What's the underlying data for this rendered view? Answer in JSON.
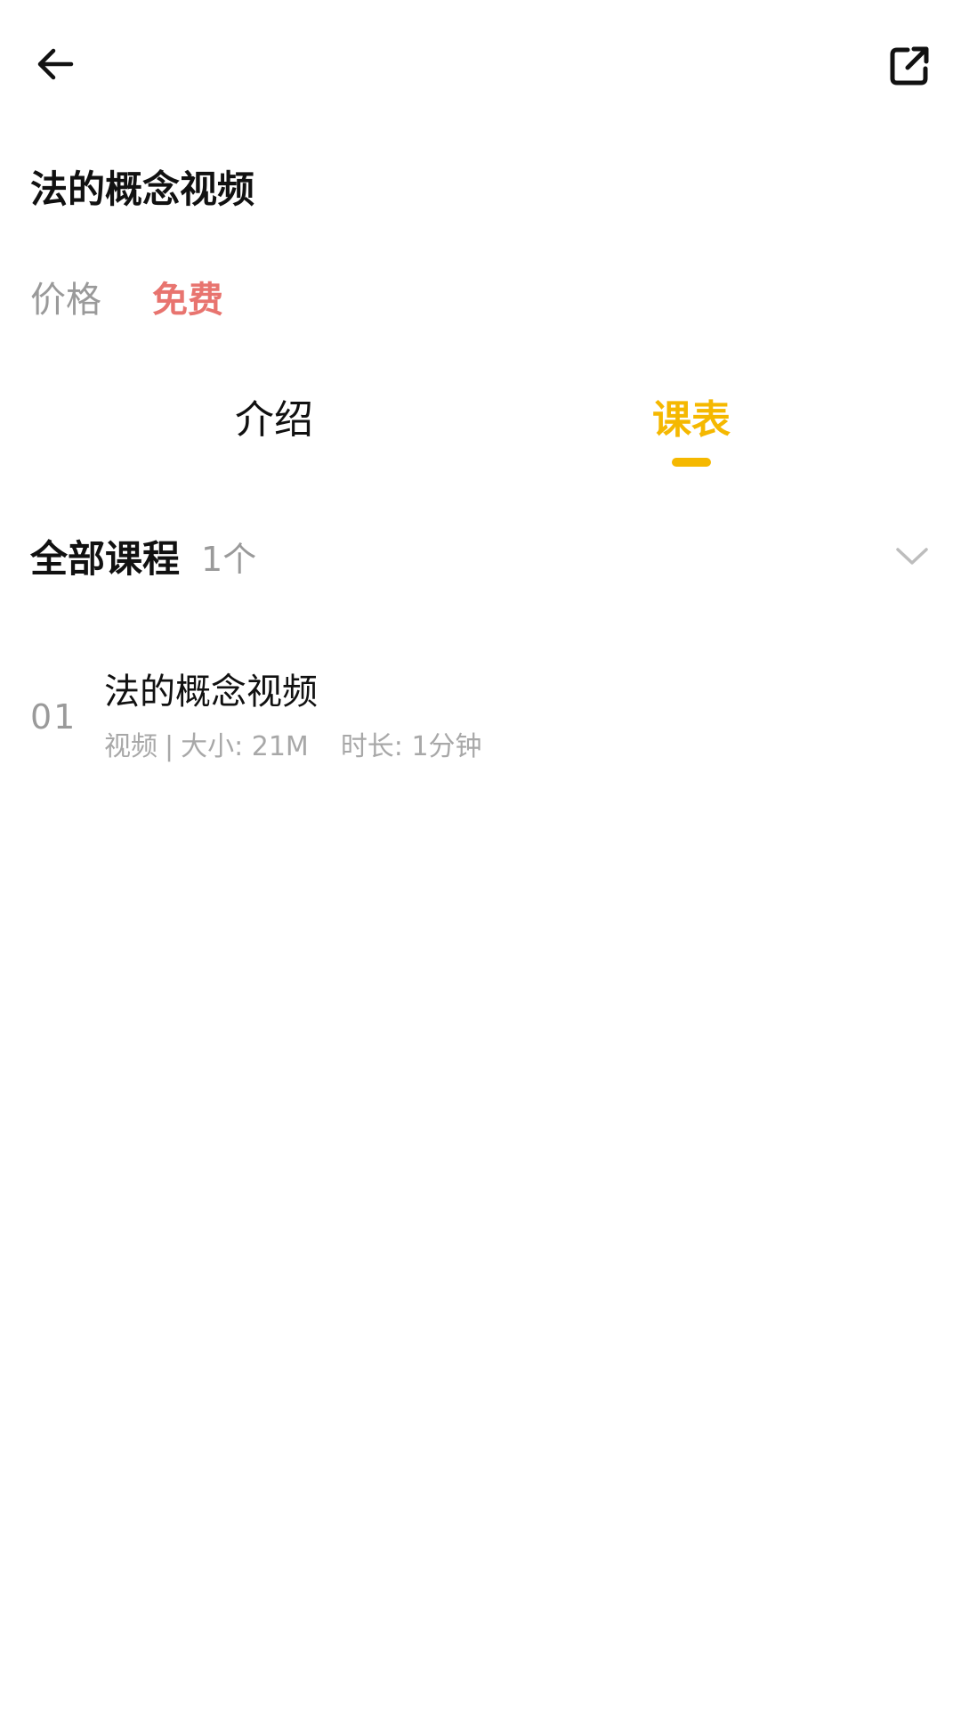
{
  "header": {
    "back_icon": "arrow-left-icon",
    "share_icon": "external-link-icon"
  },
  "course": {
    "title": "法的概念视频",
    "price_label": "价格",
    "price_value": "免费",
    "price_color": "#e8746f"
  },
  "tabs": [
    {
      "label": "介绍",
      "active": false
    },
    {
      "label": "课表",
      "active": true
    }
  ],
  "accent_color": "#f5b800",
  "section": {
    "title": "全部课程",
    "count": "1个",
    "expand_icon": "chevron-down-icon"
  },
  "lessons": [
    {
      "index": "01",
      "title": "法的概念视频",
      "type": "视频",
      "separator": "|",
      "size": "大小: 21M",
      "duration": "时长: 1分钟"
    }
  ]
}
